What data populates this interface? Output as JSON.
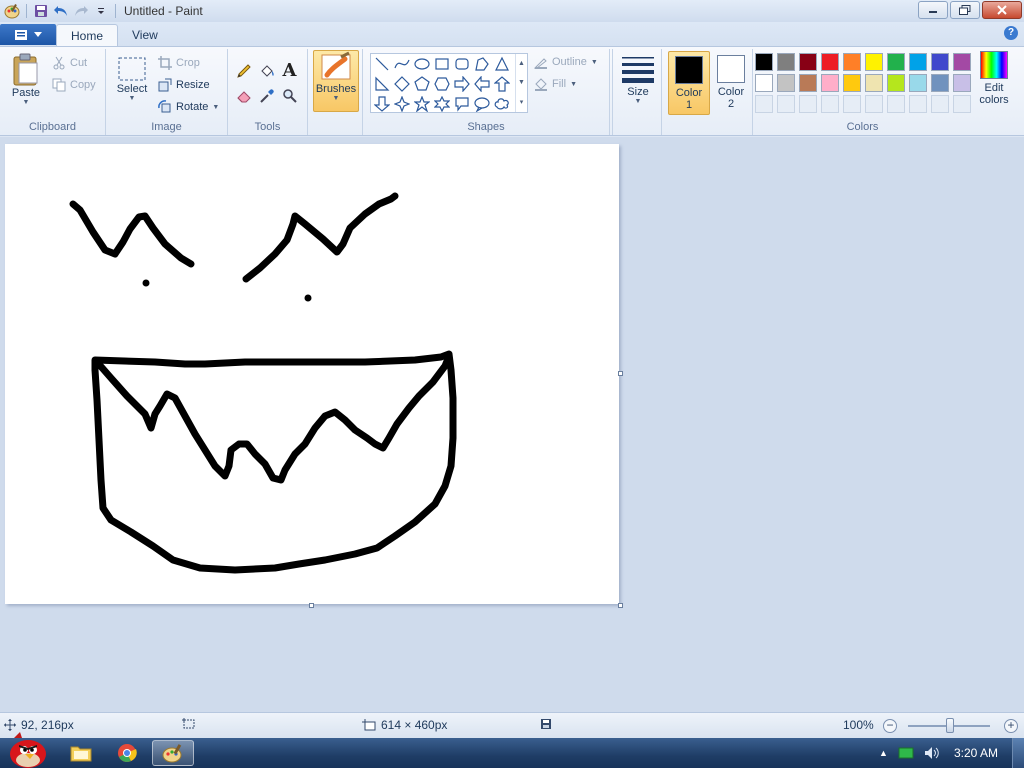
{
  "window": {
    "title": "Untitled - Paint"
  },
  "tabs": [
    {
      "label": "Home",
      "active": true
    },
    {
      "label": "View",
      "active": false
    }
  ],
  "clipboard": {
    "group_label": "Clipboard",
    "paste": "Paste",
    "cut": "Cut",
    "copy": "Copy"
  },
  "image": {
    "group_label": "Image",
    "select": "Select",
    "crop": "Crop",
    "resize": "Resize",
    "rotate": "Rotate"
  },
  "tools": {
    "group_label": "Tools",
    "text_tool_glyph": "A"
  },
  "brushes": {
    "label": "Brushes"
  },
  "shapes": {
    "group_label": "Shapes",
    "outline": "Outline",
    "fill": "Fill"
  },
  "size": {
    "label": "Size"
  },
  "colors": {
    "group_label": "Colors",
    "color1_label": "Color",
    "color1_num": "1",
    "color2_label": "Color",
    "color2_num": "2",
    "edit_label_1": "Edit",
    "edit_label_2": "colors",
    "color1_value": "#000000",
    "color2_value": "#ffffff",
    "palette_row1": [
      "#000000",
      "#7f7f7f",
      "#880015",
      "#ed1c24",
      "#ff7f27",
      "#fff200",
      "#22b14c",
      "#00a2e8",
      "#3f48cc",
      "#a349a4"
    ],
    "palette_row2": [
      "#ffffff",
      "#c3c3c3",
      "#b97a57",
      "#ffaec9",
      "#ffc90e",
      "#efe4b0",
      "#b5e61d",
      "#99d9ea",
      "#7092be",
      "#c8bfe7"
    ]
  },
  "status": {
    "cursor_pos": "92, 216px",
    "canvas_size": "614 × 460px",
    "zoom": "100%"
  },
  "taskbar": {
    "clock": "3:20 AM"
  }
}
